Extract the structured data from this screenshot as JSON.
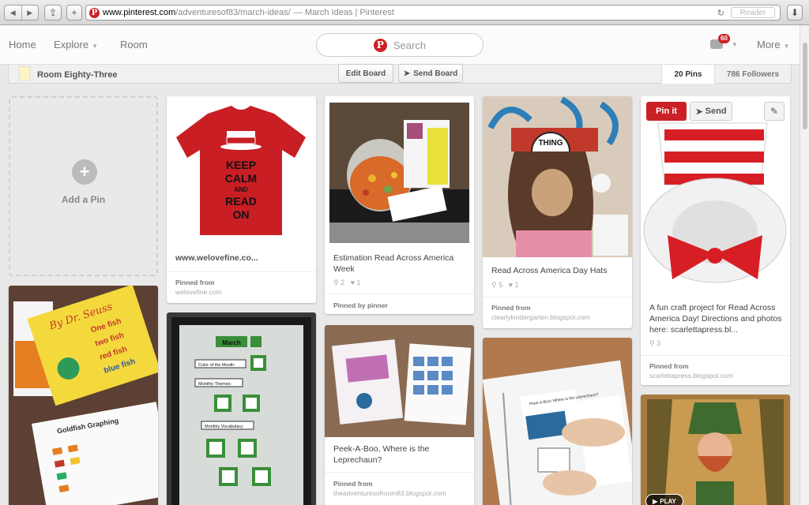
{
  "browser": {
    "url_host": "www.pinterest.com",
    "url_path": "/adventuresof83/march-ideas/",
    "page_title": "— March Ideas | Pinterest",
    "reader_label": "Reader",
    "new_tab": "+"
  },
  "header": {
    "nav": {
      "home": "Home",
      "explore": "Explore",
      "room": "Room",
      "more": "More"
    },
    "search_placeholder": "Search",
    "notif_count": "60"
  },
  "board": {
    "name": "Room Eighty-Three",
    "edit_label": "Edit Board",
    "send_label": "Send Board",
    "pins_stat": "20 Pins",
    "followers_stat": "786 Followers"
  },
  "add_pin_label": "Add a Pin",
  "pins": [
    {
      "desc": "www.welovefine.co...",
      "src_label": "Pinned from",
      "src": "welovefine.com"
    },
    {
      "desc": "Estimation Read Across America Week",
      "repins": "2",
      "likes": "1",
      "src_label": "Pinned by pinner",
      "src": ""
    },
    {
      "desc": "Read Across America Day Hats",
      "repins": "5",
      "likes": "1",
      "src_label": "Pinned from",
      "src": "clearlykindergarten.blogspot.com",
      "hat_text": "THING",
      "hat_num": "1"
    },
    {
      "desc": "A fun craft project for Read Across America Day! Directions and photos here: scarlettapress.bl...",
      "repins": "3",
      "src_label": "Pinned from",
      "src": "scarlettapress.blogspot.com",
      "pinit_label": "Pin it",
      "send_label": "Send"
    },
    {
      "src": "",
      "book_text": [
        "One fish",
        "two fish",
        "red fish",
        "blue fish"
      ],
      "book_author": "By Dr. Seuss",
      "chart_title": "Goldfish Graphing"
    },
    {
      "board_title": "March",
      "labels": [
        "Color of the Month:",
        "Monthly Themes:",
        "Monthly Vocabulary:"
      ]
    },
    {
      "desc": "Peek-A-Boo, Where is the Leprechaun?",
      "src_label": "Pinned from",
      "src": "theadventuresofroom83.blogspot.com"
    },
    {
      "binder_text": "Peek-A-Boo! Where is the Leprechaun?"
    },
    {
      "play_label": "PLAY"
    }
  ],
  "shirt": {
    "lines": [
      "KEEP",
      "CALM",
      "AND",
      "READ",
      "ON"
    ]
  },
  "colors": {
    "brand": "#cb2027",
    "background": "#e9e9e9"
  }
}
